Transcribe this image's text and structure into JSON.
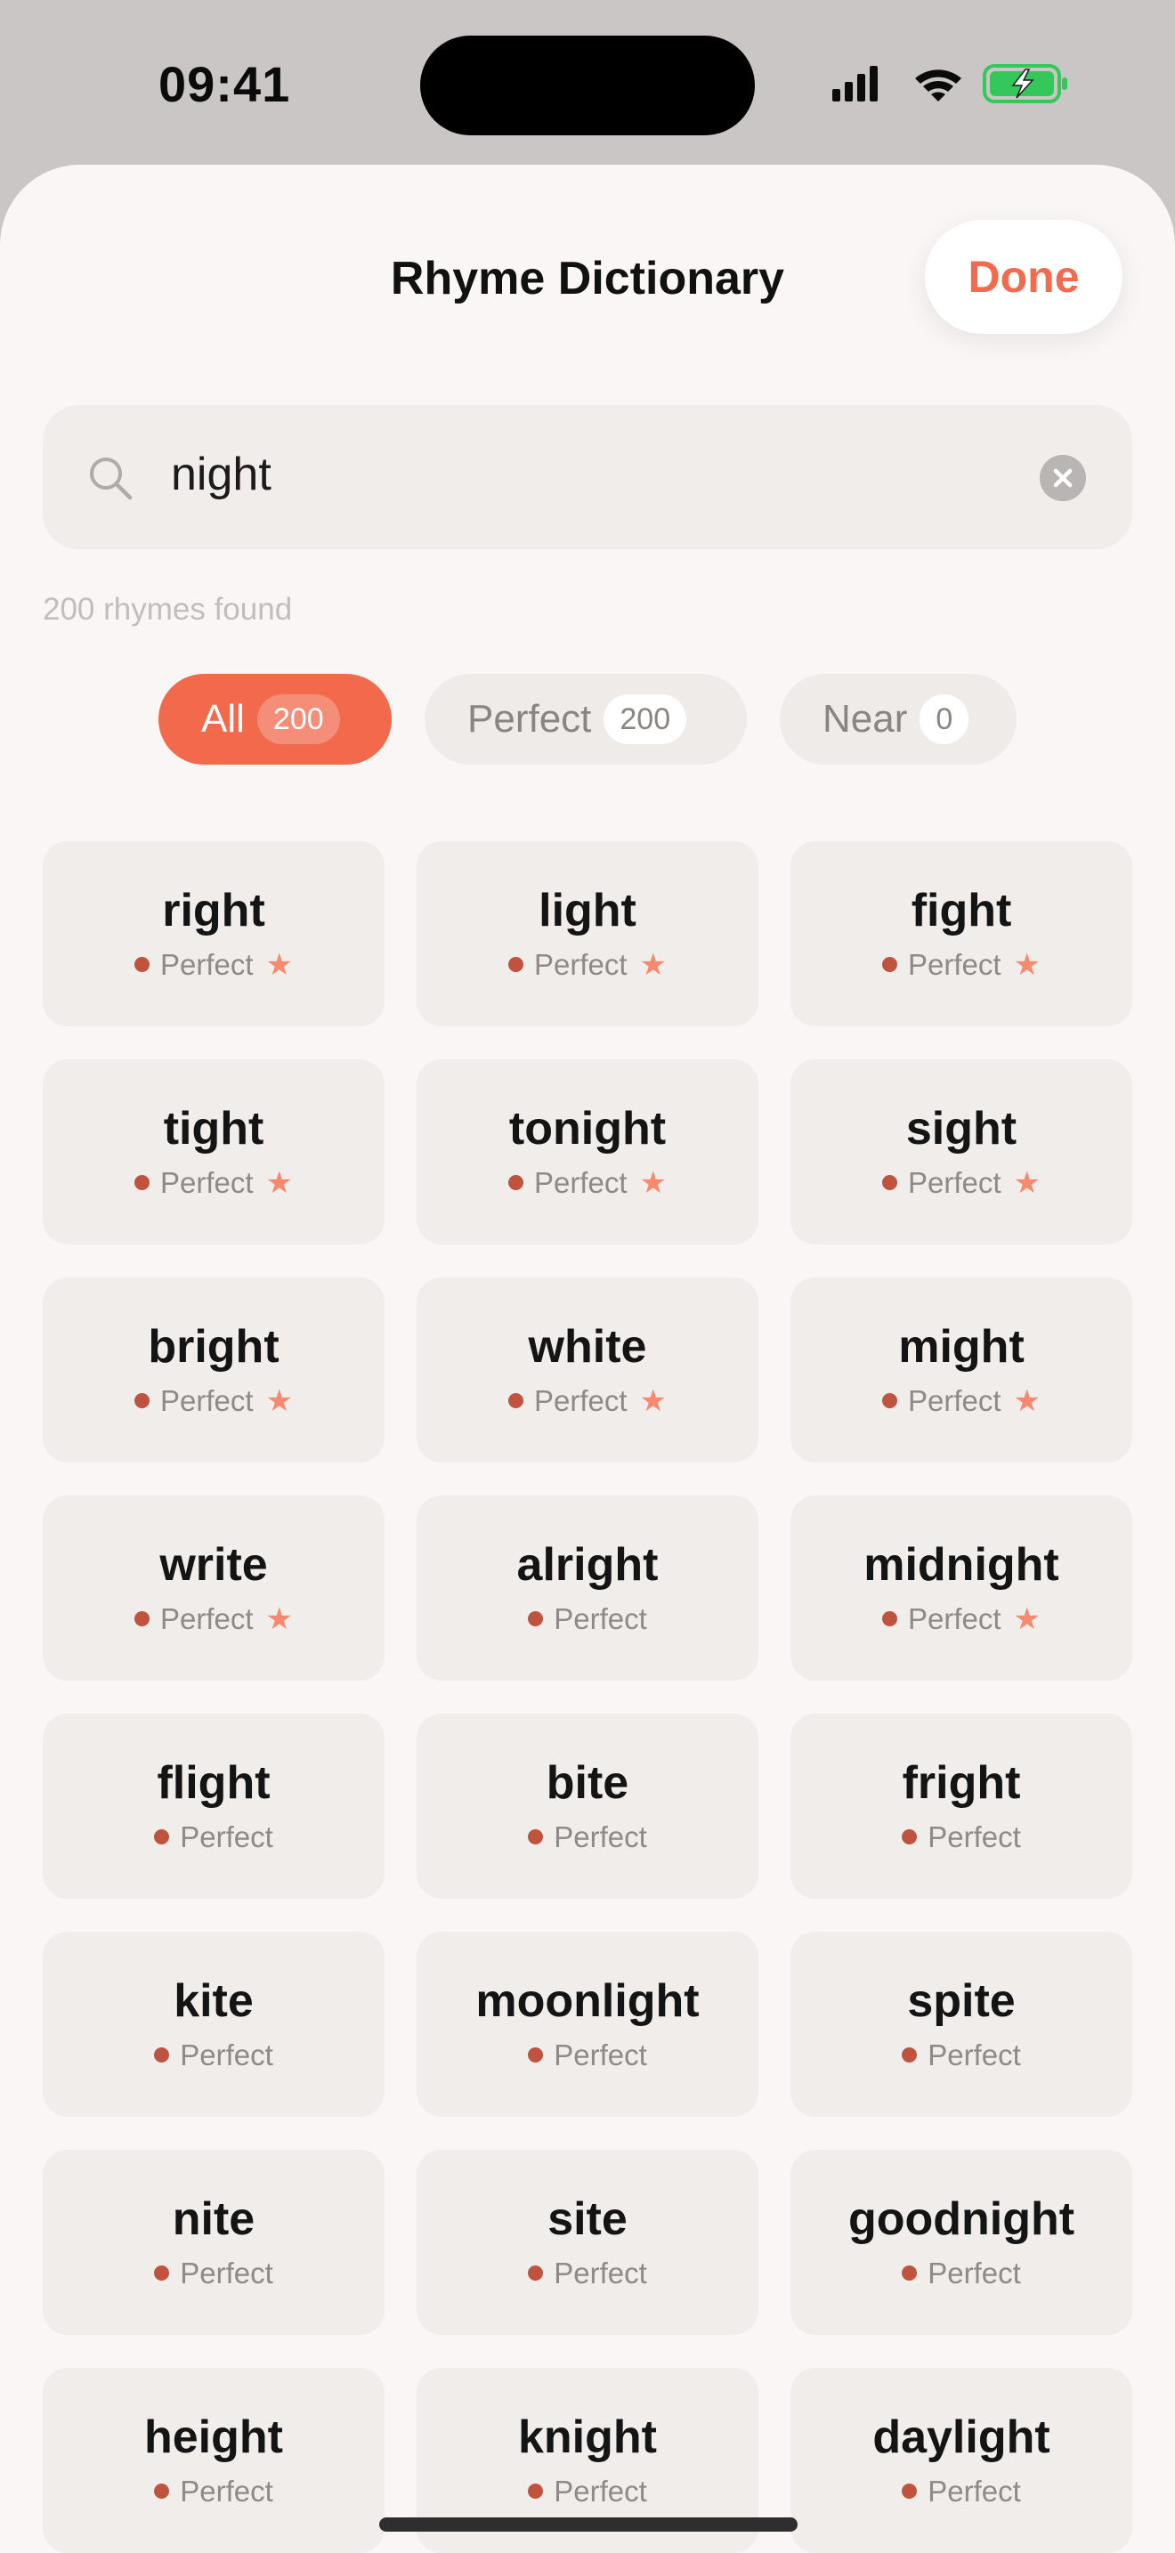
{
  "status_bar": {
    "time": "09:41"
  },
  "header": {
    "title": "Rhyme Dictionary",
    "done_label": "Done"
  },
  "search": {
    "value": "night"
  },
  "result_count": "200 rhymes found",
  "filters": [
    {
      "label": "All",
      "count": "200",
      "active": true
    },
    {
      "label": "Perfect",
      "count": "200",
      "active": false
    },
    {
      "label": "Near",
      "count": "0",
      "active": false
    }
  ],
  "colors": {
    "accent": "#f2694c",
    "dot": "#c0533e",
    "star": "#f58a6e"
  },
  "rhymes": [
    {
      "word": "right",
      "type": "Perfect",
      "starred": true
    },
    {
      "word": "light",
      "type": "Perfect",
      "starred": true
    },
    {
      "word": "fight",
      "type": "Perfect",
      "starred": true
    },
    {
      "word": "tight",
      "type": "Perfect",
      "starred": true
    },
    {
      "word": "tonight",
      "type": "Perfect",
      "starred": true
    },
    {
      "word": "sight",
      "type": "Perfect",
      "starred": true
    },
    {
      "word": "bright",
      "type": "Perfect",
      "starred": true
    },
    {
      "word": "white",
      "type": "Perfect",
      "starred": true
    },
    {
      "word": "might",
      "type": "Perfect",
      "starred": true
    },
    {
      "word": "write",
      "type": "Perfect",
      "starred": true
    },
    {
      "word": "alright",
      "type": "Perfect",
      "starred": false
    },
    {
      "word": "midnight",
      "type": "Perfect",
      "starred": true
    },
    {
      "word": "flight",
      "type": "Perfect",
      "starred": false
    },
    {
      "word": "bite",
      "type": "Perfect",
      "starred": false
    },
    {
      "word": "fright",
      "type": "Perfect",
      "starred": false
    },
    {
      "word": "kite",
      "type": "Perfect",
      "starred": false
    },
    {
      "word": "moonlight",
      "type": "Perfect",
      "starred": false
    },
    {
      "word": "spite",
      "type": "Perfect",
      "starred": false
    },
    {
      "word": "nite",
      "type": "Perfect",
      "starred": false
    },
    {
      "word": "site",
      "type": "Perfect",
      "starred": false
    },
    {
      "word": "goodnight",
      "type": "Perfect",
      "starred": false
    },
    {
      "word": "height",
      "type": "Perfect",
      "starred": false
    },
    {
      "word": "knight",
      "type": "Perfect",
      "starred": false
    },
    {
      "word": "daylight",
      "type": "Perfect",
      "starred": false
    }
  ]
}
